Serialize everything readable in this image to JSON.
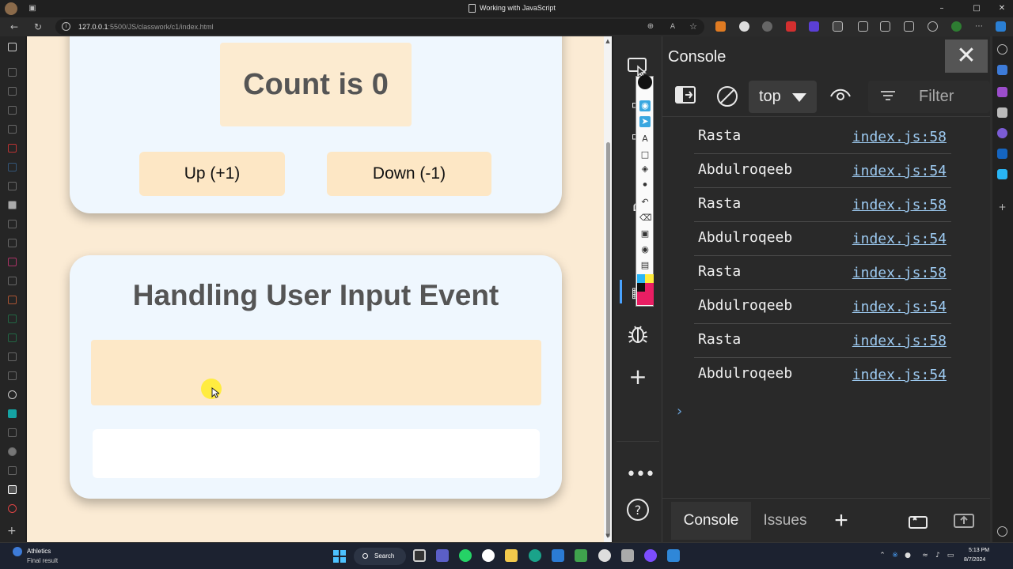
{
  "window": {
    "title": "Working with JavaScript"
  },
  "address_bar": {
    "host": "127.0.0.1",
    "path": ":5500/JS/classwork/c1/index.html"
  },
  "page": {
    "counter": {
      "count_text": "Count is 0",
      "up_label": "Up (+1)",
      "down_label": "Down (-1)"
    },
    "input_section": {
      "heading": "Handling User Input Event",
      "input_value": "",
      "output_text": ""
    }
  },
  "devtools": {
    "panel_title": "Console",
    "context": "top",
    "filter_placeholder": "Filter",
    "logs": [
      {
        "message": "Rasta",
        "source": "index.js:58"
      },
      {
        "message": "Abdulroqeeb",
        "source": "index.js:54"
      },
      {
        "message": "Rasta",
        "source": "index.js:58"
      },
      {
        "message": "Abdulroqeeb",
        "source": "index.js:54"
      },
      {
        "message": "Rasta",
        "source": "index.js:58"
      },
      {
        "message": "Abdulroqeeb",
        "source": "index.js:54"
      },
      {
        "message": "Rasta",
        "source": "index.js:58"
      },
      {
        "message": "Abdulroqeeb",
        "source": "index.js:54"
      }
    ],
    "drawer_tabs": {
      "console": "Console",
      "issues": "Issues"
    }
  },
  "taskbar": {
    "weather_title": "Athletics",
    "weather_subtitle": "Final result",
    "search_label": "Search",
    "clock_time": "5:13 PM",
    "clock_date": "8/7/2024"
  },
  "colors": {
    "page_background": "#fbebd4",
    "card_background": "#eff7fe",
    "button_background": "#fde7c5",
    "console_background": "#292929",
    "link_color": "#9cc9f0"
  }
}
